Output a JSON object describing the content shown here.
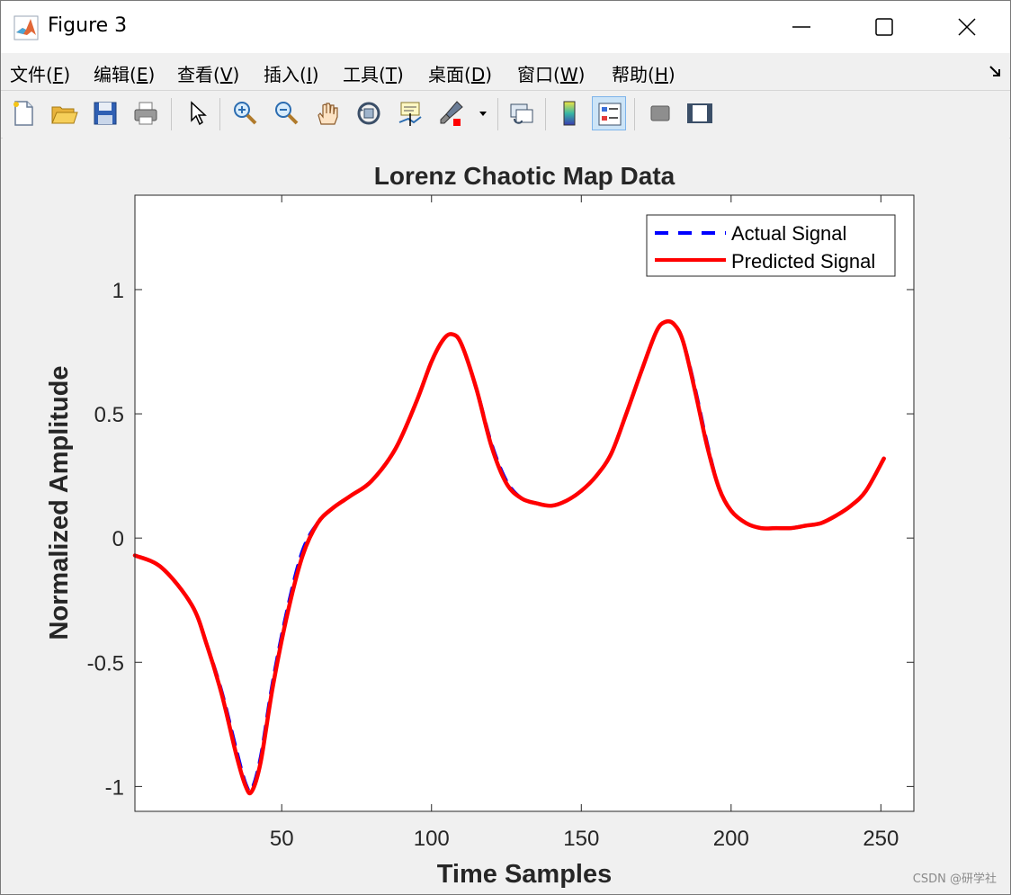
{
  "window": {
    "title": "Figure 3",
    "controls": {
      "minimize": "minimize",
      "maximize": "maximize",
      "close": "close"
    }
  },
  "menubar": {
    "items": [
      {
        "text": "文件(",
        "hotkey": "F",
        "suffix": ")"
      },
      {
        "text": "编辑(",
        "hotkey": "E",
        "suffix": ")"
      },
      {
        "text": "查看(",
        "hotkey": "V",
        "suffix": ")"
      },
      {
        "text": "插入(",
        "hotkey": "I",
        "suffix": ")"
      },
      {
        "text": "工具(",
        "hotkey": "T",
        "suffix": ")"
      },
      {
        "text": "桌面(",
        "hotkey": "D",
        "suffix": ")"
      },
      {
        "text": "窗口(",
        "hotkey": "W",
        "suffix": ")"
      },
      {
        "text": "帮助(",
        "hotkey": "H",
        "suffix": ")"
      }
    ]
  },
  "toolbar": {
    "icons": [
      "new-figure-icon",
      "open-file-icon",
      "save-icon",
      "print-icon",
      "select-arrow-icon",
      "zoom-in-icon",
      "zoom-out-icon",
      "pan-hand-icon",
      "rotate-3d-icon",
      "data-cursor-icon",
      "brush-icon",
      "link-plot-icon",
      "colorbar-icon",
      "legend-icon",
      "hide-plot-tools-icon",
      "show-plot-tools-icon"
    ],
    "active": "legend-icon"
  },
  "chart_data": {
    "type": "line",
    "title": "Lorenz Chaotic Map Data",
    "xlabel": "Time Samples",
    "ylabel": "Normalized Amplitude",
    "xlim": [
      1,
      261
    ],
    "ylim": [
      -1.1,
      1.38
    ],
    "xticks": [
      50,
      100,
      150,
      200,
      250
    ],
    "xtick_labels": [
      "50",
      "100",
      "150",
      "200",
      "250"
    ],
    "yticks": [
      1,
      0.5,
      0,
      -0.5,
      -1
    ],
    "ytick_labels": [
      "1",
      "0.5",
      "0",
      "-0.5",
      "-1"
    ],
    "legend_position": "top-right",
    "grid": false,
    "series": [
      {
        "name": "Actual Signal",
        "style": "dashed",
        "color": "#0000ff",
        "x": [
          1,
          10,
          20,
          25,
          30,
          35,
          38,
          40,
          43,
          47,
          52,
          57,
          62,
          67,
          73,
          80,
          88,
          95,
          100,
          104,
          107,
          110,
          115,
          120,
          125,
          130,
          135,
          140,
          145,
          150,
          155,
          160,
          165,
          170,
          175,
          178,
          181,
          184,
          188,
          192,
          196,
          200,
          205,
          210,
          215,
          220,
          225,
          230,
          235,
          240,
          245,
          251
        ],
        "y": [
          -0.07,
          -0.12,
          -0.27,
          -0.43,
          -0.62,
          -0.86,
          -0.99,
          -1.01,
          -0.88,
          -0.58,
          -0.28,
          -0.05,
          0.06,
          0.12,
          0.17,
          0.23,
          0.36,
          0.55,
          0.71,
          0.8,
          0.82,
          0.78,
          0.6,
          0.38,
          0.23,
          0.16,
          0.14,
          0.13,
          0.15,
          0.19,
          0.25,
          0.34,
          0.5,
          0.67,
          0.83,
          0.87,
          0.86,
          0.79,
          0.6,
          0.38,
          0.2,
          0.11,
          0.06,
          0.04,
          0.04,
          0.04,
          0.05,
          0.06,
          0.09,
          0.13,
          0.19,
          0.32
        ]
      },
      {
        "name": "Predicted Signal",
        "style": "solid",
        "color": "#ff0000",
        "x": [
          1,
          10,
          20,
          25,
          30,
          35,
          38,
          40,
          43,
          47,
          52,
          57,
          62,
          67,
          73,
          80,
          88,
          95,
          100,
          104,
          107,
          110,
          115,
          120,
          125,
          130,
          135,
          140,
          145,
          150,
          155,
          160,
          165,
          170,
          175,
          178,
          181,
          184,
          188,
          192,
          196,
          200,
          205,
          210,
          215,
          220,
          225,
          230,
          235,
          240,
          245,
          251
        ],
        "y": [
          -0.07,
          -0.12,
          -0.27,
          -0.43,
          -0.63,
          -0.88,
          -1.0,
          -1.02,
          -0.9,
          -0.6,
          -0.3,
          -0.07,
          0.06,
          0.12,
          0.17,
          0.23,
          0.36,
          0.55,
          0.71,
          0.8,
          0.82,
          0.78,
          0.6,
          0.37,
          0.22,
          0.16,
          0.14,
          0.13,
          0.15,
          0.19,
          0.25,
          0.34,
          0.5,
          0.67,
          0.83,
          0.87,
          0.86,
          0.79,
          0.59,
          0.37,
          0.2,
          0.11,
          0.06,
          0.04,
          0.04,
          0.04,
          0.05,
          0.06,
          0.09,
          0.13,
          0.19,
          0.32
        ]
      }
    ]
  },
  "watermark": "CSDN @研学社",
  "colors": {
    "axes_bg": "#ffffff",
    "figure_bg": "#f0f0f0",
    "actual": "#0000ff",
    "predicted": "#ff0000"
  }
}
